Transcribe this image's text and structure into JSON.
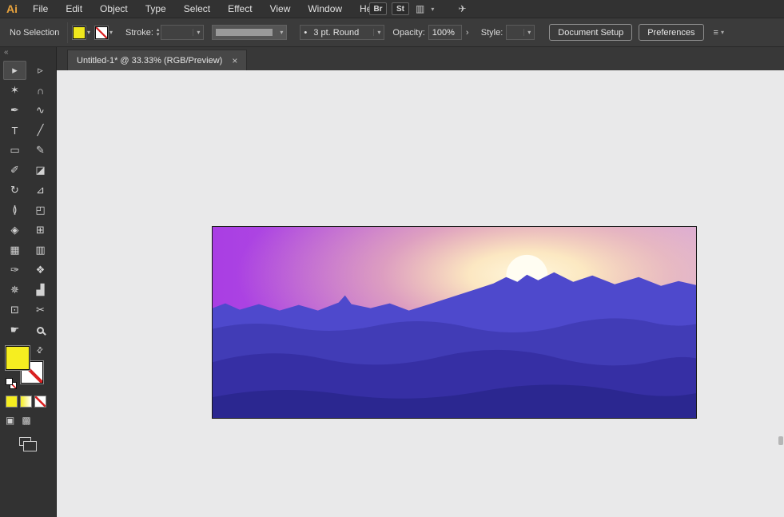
{
  "menu_bar": {
    "logo": "Ai",
    "logo_color": "#e8a33d",
    "items": [
      "File",
      "Edit",
      "Object",
      "Type",
      "Select",
      "Effect",
      "View",
      "Window",
      "Help"
    ],
    "brushes_button": "Br",
    "graphic_styles_button": "St",
    "workspace_icon_glyph": "▥",
    "gpu_icon_glyph": "✈"
  },
  "icons": {
    "chevron_down": "▾",
    "chevron_right": "›",
    "stepper_up": "▴",
    "stepper_down": "▾",
    "close": "×",
    "collapse_left": "«",
    "swap": "⇄",
    "panel_menu": "≡",
    "draw_normal": "▣",
    "draw_behind": "▩"
  },
  "control_bar": {
    "selection_status": "No Selection",
    "fill_color": "#efe71d",
    "stroke_label": "Stroke:",
    "stroke_weight_value": "",
    "brush_bullet": "•",
    "brush_value": "3 pt. Round",
    "opacity_label": "Opacity:",
    "opacity_value": "100%",
    "style_label": "Style:",
    "style_value": "",
    "document_setup_button": "Document Setup",
    "preferences_button": "Preferences"
  },
  "tab_bar": {
    "active_tab_title": "Untitled-1* @ 33.33% (RGB/Preview)"
  },
  "toolbar": {
    "fill_color": "#f6ee20",
    "tools": [
      {
        "name": "selection-tool",
        "glyph": "▸"
      },
      {
        "name": "direct-selection-tool",
        "glyph": "▹"
      },
      {
        "name": "magic-wand-tool",
        "glyph": "✶"
      },
      {
        "name": "lasso-tool",
        "glyph": "∩"
      },
      {
        "name": "pen-tool",
        "glyph": "✒"
      },
      {
        "name": "curvature-tool",
        "glyph": "∿"
      },
      {
        "name": "type-tool",
        "glyph": "T"
      },
      {
        "name": "line-segment-tool",
        "glyph": "╱"
      },
      {
        "name": "rectangle-tool",
        "glyph": "▭"
      },
      {
        "name": "paintbrush-tool",
        "glyph": "✎"
      },
      {
        "name": "pencil-tool",
        "glyph": "✐"
      },
      {
        "name": "eraser-tool",
        "glyph": "◪"
      },
      {
        "name": "rotate-tool",
        "glyph": "↻"
      },
      {
        "name": "scale-tool",
        "glyph": "⊿"
      },
      {
        "name": "width-tool",
        "glyph": "≬"
      },
      {
        "name": "free-transform-tool",
        "glyph": "◰"
      },
      {
        "name": "shape-builder-tool",
        "glyph": "◈"
      },
      {
        "name": "perspective-grid-tool",
        "glyph": "⊞"
      },
      {
        "name": "mesh-tool",
        "glyph": "▦"
      },
      {
        "name": "gradient-tool",
        "glyph": "▥"
      },
      {
        "name": "eyedropper-tool",
        "glyph": "✑"
      },
      {
        "name": "blend-tool",
        "glyph": "❖"
      },
      {
        "name": "symbol-sprayer-tool",
        "glyph": "✵"
      },
      {
        "name": "column-graph-tool",
        "glyph": "▟"
      },
      {
        "name": "artboard-tool",
        "glyph": "⊡"
      },
      {
        "name": "slice-tool",
        "glyph": "✂"
      },
      {
        "name": "hand-tool",
        "glyph": "☛"
      },
      {
        "name": "zoom-tool",
        "glyph": ""
      }
    ]
  },
  "artwork": {
    "sky_left": "#a93ee3",
    "sky_mid": "#bb60e0",
    "sky_right": "#cf9ae6",
    "glow_core": "#fff7dc",
    "glow_inner": "#ffeec0",
    "glow_outer": "#fdd9a6",
    "sun_color": "#fffdf2",
    "mountains": [
      "#4e49cc",
      "#413cb6",
      "#362fa4",
      "#2b2790"
    ]
  }
}
